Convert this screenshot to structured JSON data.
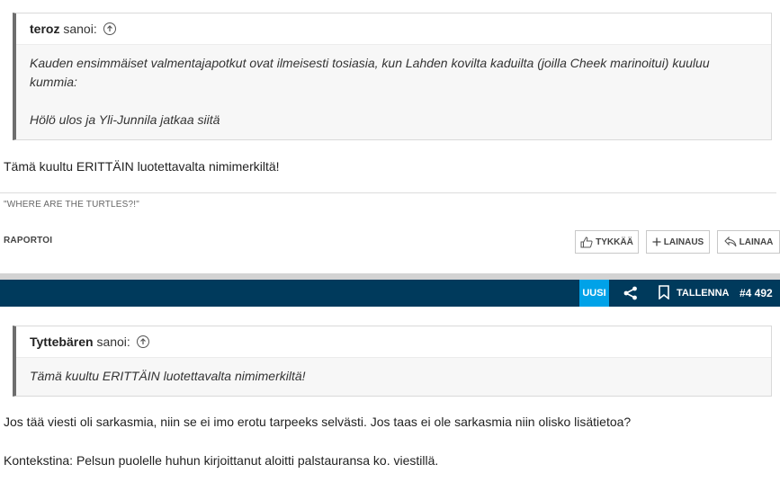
{
  "post1": {
    "quote": {
      "username": "teroz",
      "said_label": "sanoi:",
      "lines": [
        "Kauden ensimmäiset valmentajapotkut ovat ilmeisesti tosiasia, kun Lahden kovilta kaduilta (joilla Cheek marinoitui) kuuluu kummia:",
        "Hölö ulos ja Yli-Junnila jatkaa siitä"
      ]
    },
    "text": "Tämä kuultu ERITTÄIN luotettavalta nimimerkiltä!",
    "signature": "\"WHERE ARE THE TURTLES?!\"",
    "report_label": "RAPORTOI",
    "actions": {
      "like": "TYKKÄÄ",
      "quote": "LAINAUS",
      "reply": "LAINAA"
    }
  },
  "post_bar": {
    "new_label": "UUSI",
    "save_label": "TALLENNA",
    "post_number": "#4 492"
  },
  "post2": {
    "quote": {
      "username": "Tyttebären",
      "said_label": "sanoi:",
      "line": "Tämä kuultu ERITTÄIN luotettavalta nimimerkiltä!"
    },
    "paragraphs": [
      "Jos tää viesti oli sarkasmia, niin se ei imo erotu tarpeeks selvästi. Jos taas ei ole sarkasmia niin olisko lisätietoa?",
      "Kontekstina: Pelsun puolelle huhun kirjoittanut aloitti palstauransa ko. viestillä."
    ]
  },
  "colors": {
    "post_bar_bg": "#003a5c",
    "new_badge": "#00a2e8",
    "quote_border": "#6e6e6e"
  },
  "icons": [
    "arrow-up-circle-icon",
    "thumbs-up-icon",
    "plus-icon",
    "reply-icon",
    "share-icon",
    "bookmark-icon"
  ]
}
